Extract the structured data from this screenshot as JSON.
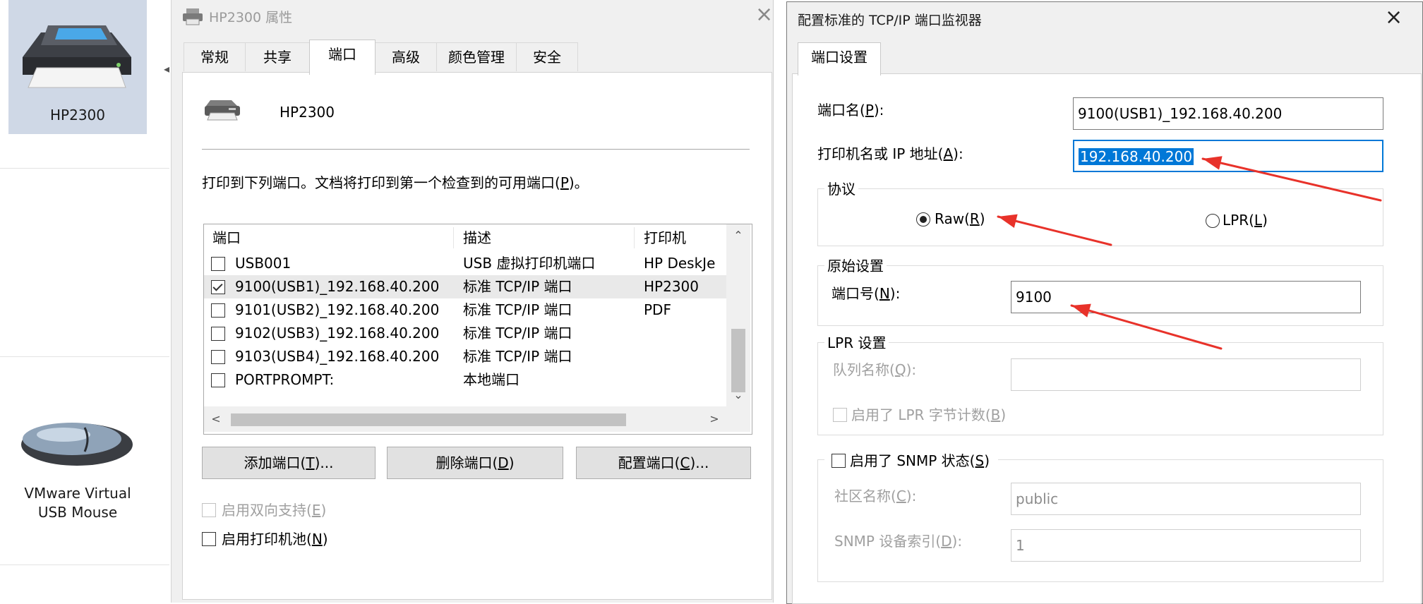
{
  "devices": [
    {
      "name": "HP2300",
      "icon": "printer-icon",
      "selected": true
    },
    {
      "name": "VMware Virtual USB Mouse",
      "line1": "VMware Virtual",
      "line2": "USB Mouse",
      "icon": "mouse-icon"
    }
  ],
  "props_dialog": {
    "title": "HP2300 属性",
    "tabs": [
      "常规",
      "共享",
      "端口",
      "高级",
      "颜色管理",
      "安全"
    ],
    "active_tab": "端口",
    "printer_name": "HP2300",
    "instruction_pre": "打印到下列端口。文档将打印到第一个检查到的可用端口(",
    "instruction_key": "P",
    "instruction_post": ")。",
    "columns": [
      "端口",
      "描述",
      "打印机"
    ],
    "ports": [
      {
        "port": "USB001",
        "desc": "USB 虚拟打印机端口",
        "printer": "HP DeskJe",
        "checked": false
      },
      {
        "port": "9100(USB1)_192.168.40.200",
        "desc": "标准 TCP/IP 端口",
        "printer": "HP2300",
        "checked": true
      },
      {
        "port": "9101(USB2)_192.168.40.200",
        "desc": "标准 TCP/IP 端口",
        "printer": "PDF",
        "checked": false
      },
      {
        "port": "9102(USB3)_192.168.40.200",
        "desc": "标准 TCP/IP 端口",
        "printer": "",
        "checked": false
      },
      {
        "port": "9103(USB4)_192.168.40.200",
        "desc": "标准 TCP/IP 端口",
        "printer": "",
        "checked": false
      },
      {
        "port": "PORTPROMPT:",
        "desc": "本地端口",
        "printer": "",
        "checked": false
      }
    ],
    "buttons": {
      "add": {
        "pre": "添加端口(",
        "key": "T",
        "post": ")..."
      },
      "delete": {
        "pre": "删除端口(",
        "key": "D",
        "post": ")"
      },
      "configure": {
        "pre": "配置端口(",
        "key": "C",
        "post": ")..."
      }
    },
    "bidi": {
      "pre": "启用双向支持(",
      "key": "E",
      "post": ")",
      "checked": false,
      "enabled": false
    },
    "pooling": {
      "pre": "启用打印机池(",
      "key": "N",
      "post": ")",
      "checked": false,
      "enabled": true
    }
  },
  "tcp_dialog": {
    "title": "配置标准的 TCP/IP 端口监视器",
    "tab": "端口设置",
    "port_name": {
      "pre": "端口名(",
      "key": "P",
      "post": "):",
      "value": "9100(USB1)_192.168.40.200"
    },
    "host": {
      "pre": "打印机名或 IP 地址(",
      "key": "A",
      "post": "):",
      "value": "192.168.40.200"
    },
    "protocol": {
      "label": "协议",
      "raw": {
        "pre": "Raw(",
        "key": "R",
        "post": ")",
        "selected": true
      },
      "lpr": {
        "pre": "LPR(",
        "key": "L",
        "post": ")",
        "selected": false
      }
    },
    "raw_settings": {
      "label": "原始设置",
      "port_num": {
        "pre": "端口号(",
        "key": "N",
        "post": "):",
        "value": "9100"
      }
    },
    "lpr_settings": {
      "label": "LPR 设置",
      "queue": {
        "pre": "队列名称(",
        "key": "Q",
        "post": "):",
        "value": ""
      },
      "byte_count": {
        "pre": "启用了 LPR 字节计数(",
        "key": "B",
        "post": ")",
        "checked": false
      }
    },
    "snmp": {
      "label": {
        "pre": "启用了 SNMP 状态(",
        "key": "S",
        "post": ")",
        "checked": false
      },
      "community": {
        "pre": "社区名称(",
        "key": "C",
        "post": "):",
        "value": "public"
      },
      "index": {
        "pre": "SNMP 设备索引(",
        "key": "D",
        "post": "):",
        "value": "1"
      }
    }
  },
  "colors": {
    "annotation_arrow": "#e8322a",
    "selection": "#0078d7",
    "focus_border": "#0078d7"
  }
}
